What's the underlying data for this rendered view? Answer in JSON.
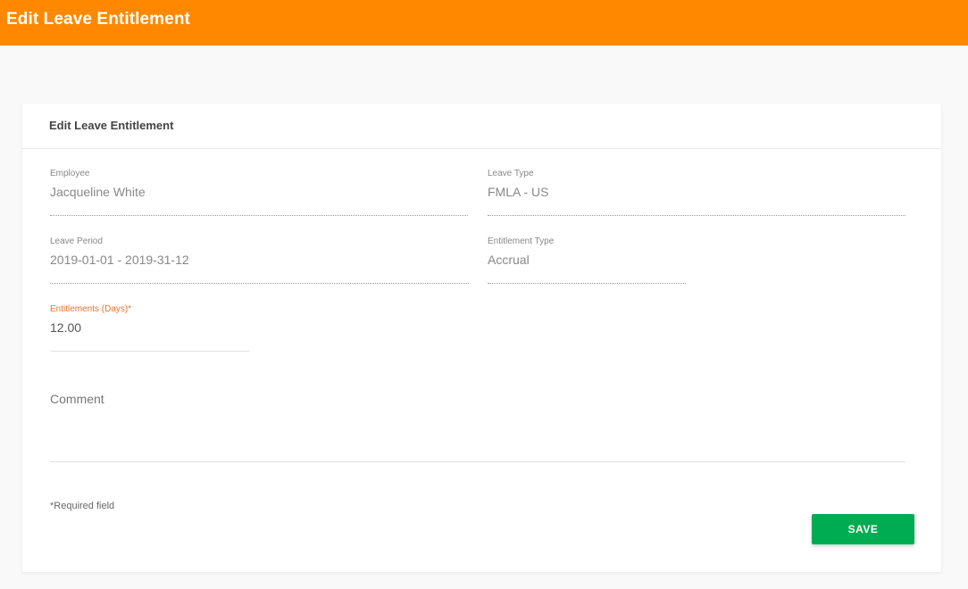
{
  "header": {
    "title": "Edit Leave Entitlement"
  },
  "card": {
    "title": "Edit Leave Entitlement"
  },
  "form": {
    "employee": {
      "label": "Employee",
      "value": "Jacqueline White"
    },
    "leave_type": {
      "label": "Leave Type",
      "value": "FMLA - US"
    },
    "leave_period": {
      "label": "Leave Period",
      "value": "2019-01-01 - 2019-31-12"
    },
    "entitlement_type": {
      "label": "Entitlement Type",
      "value": "Accrual"
    },
    "entitlements": {
      "label": "Entitlements (Days)*",
      "value": "12.00"
    },
    "comment": {
      "label": "Comment",
      "value": ""
    },
    "required_note": "*Required field",
    "save_label": "SAVE"
  },
  "colors": {
    "header_bg": "#ff8800",
    "save_bg": "#00ac51",
    "required_label": "#e8732e"
  }
}
